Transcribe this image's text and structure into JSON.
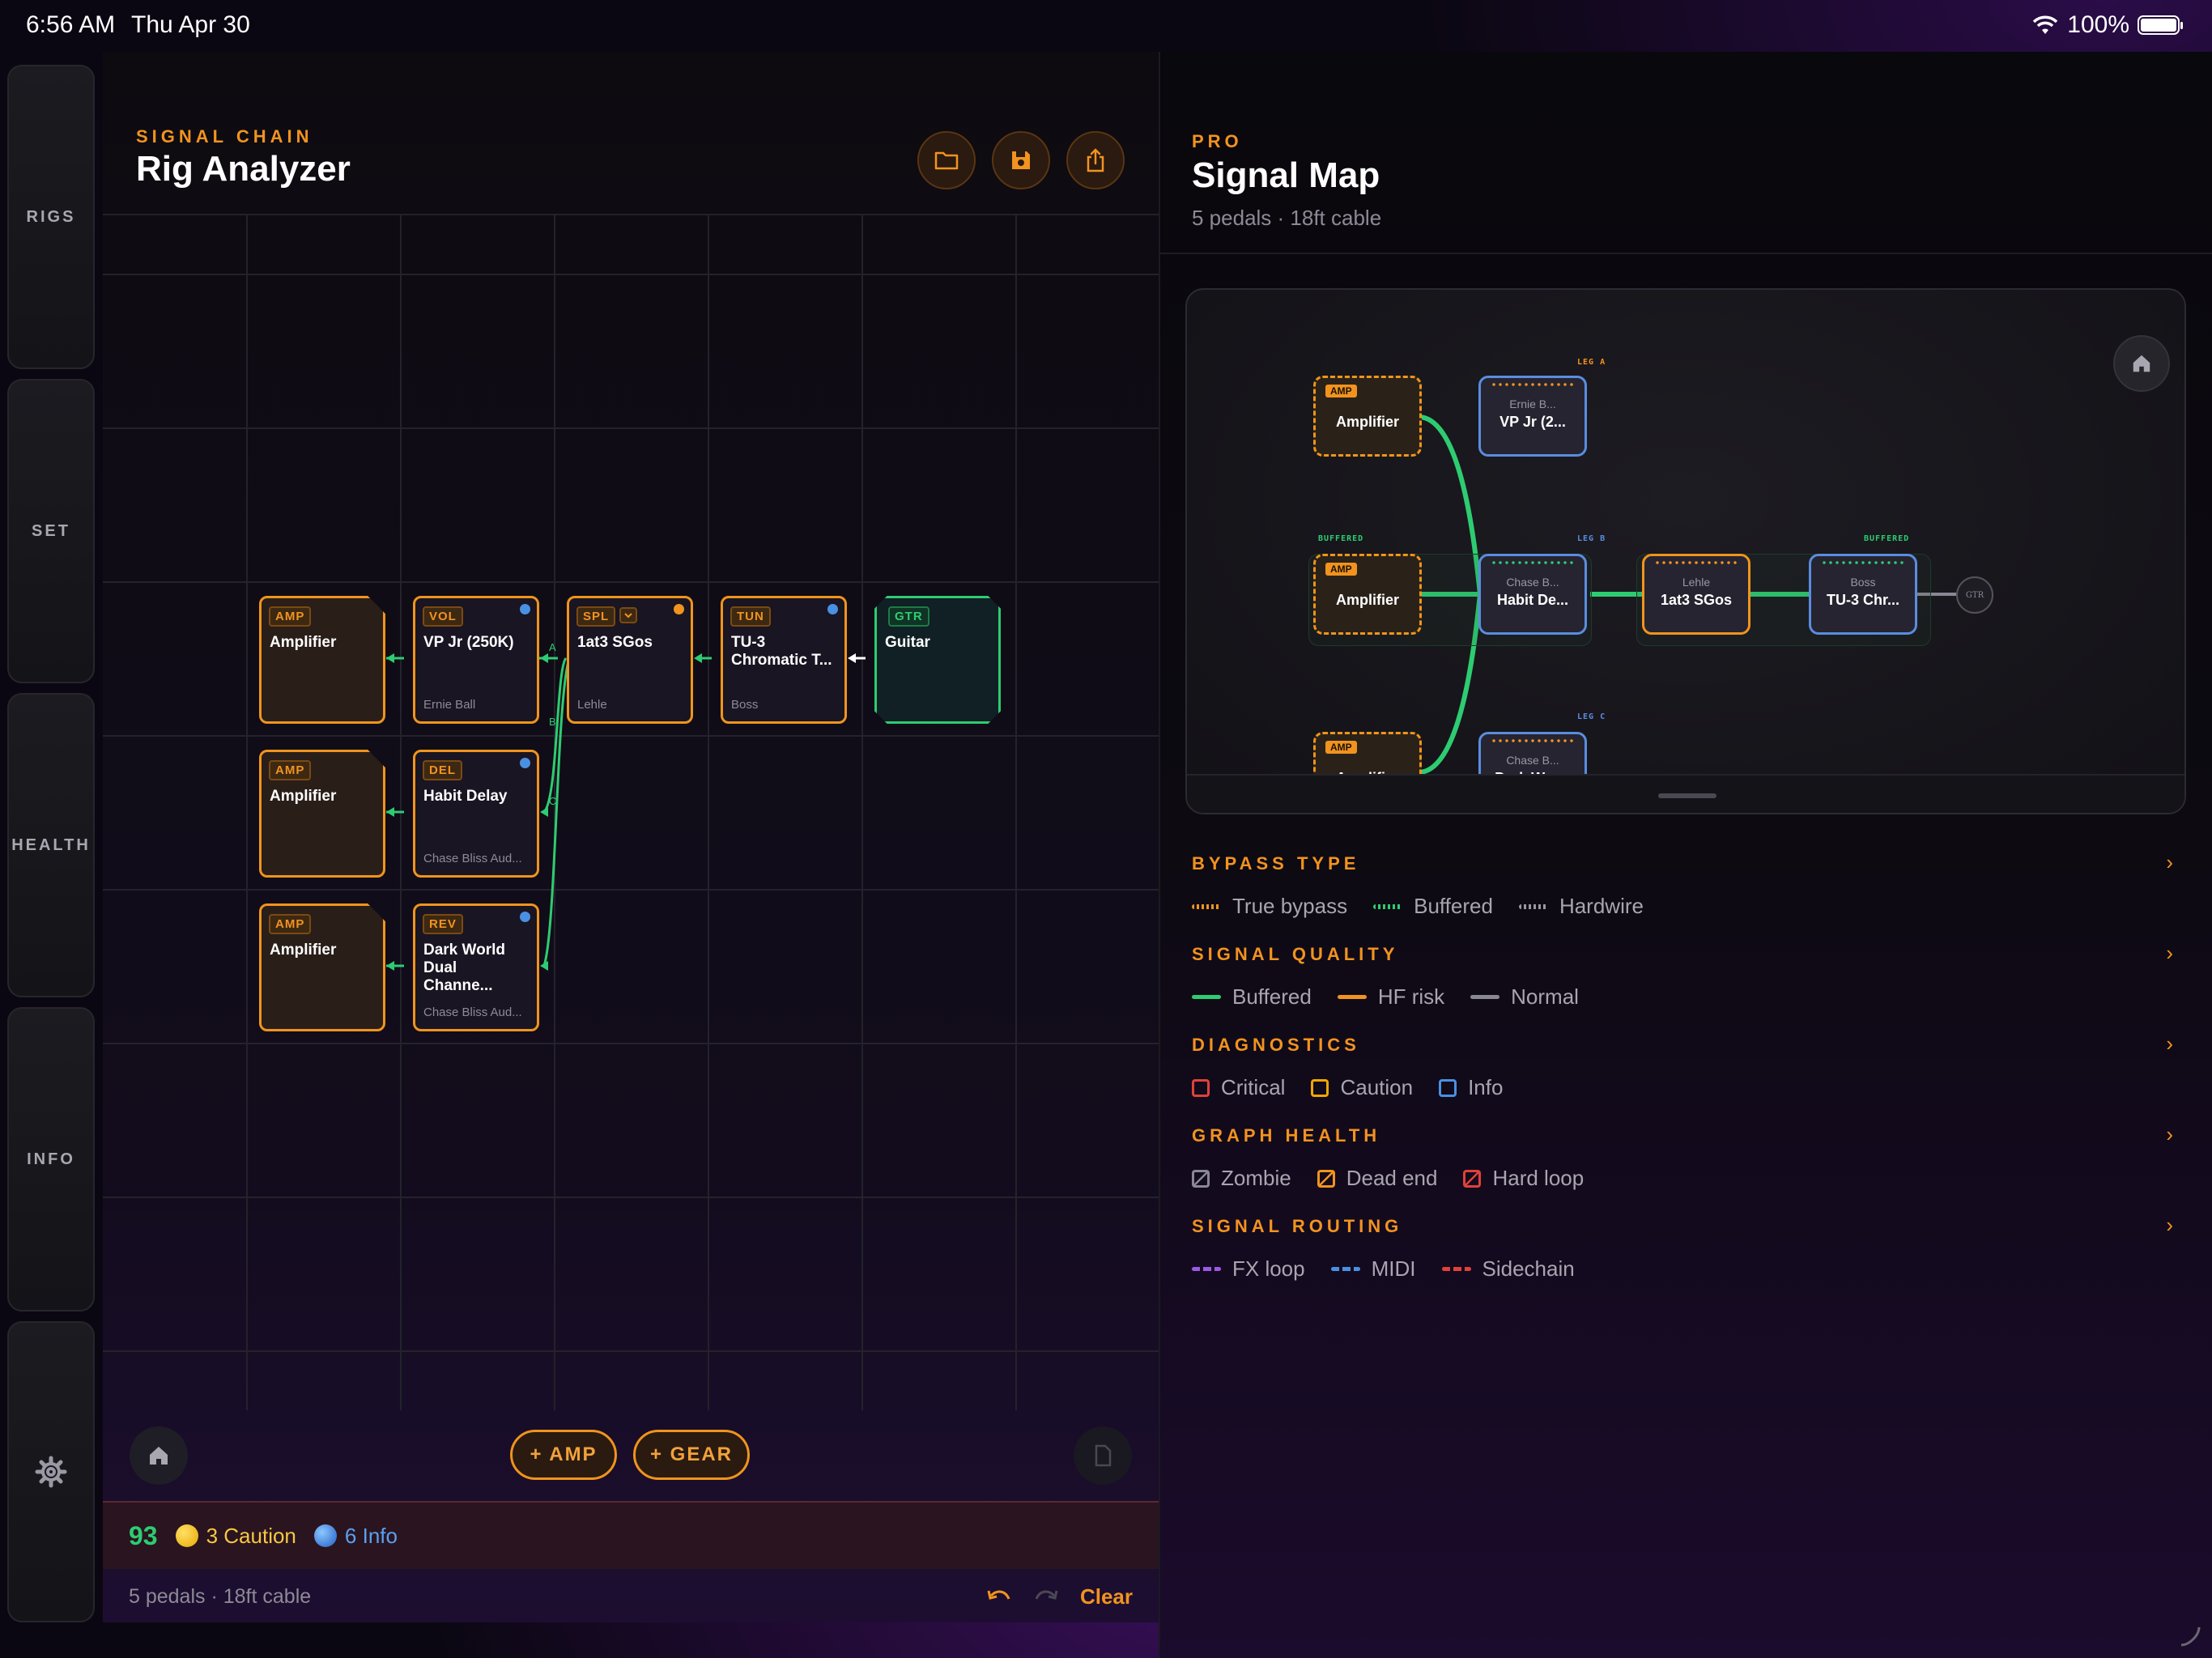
{
  "status_bar": {
    "time": "6:56 AM",
    "date": "Thu Apr 30",
    "battery": "100%"
  },
  "sidebar": {
    "tabs": [
      {
        "label": "RIGS"
      },
      {
        "label": "SET"
      },
      {
        "label": "HEALTH"
      },
      {
        "label": "INFO"
      }
    ]
  },
  "left": {
    "kicker": "SIGNAL CHAIN",
    "title": "Rig Analyzer",
    "nodes": [
      {
        "badge": "AMP",
        "name": "Amplifier",
        "brand": ""
      },
      {
        "badge": "VOL",
        "name": "VP Jr (250K)",
        "brand": "Ernie Ball"
      },
      {
        "badge": "SPL",
        "name": "1at3 SGos",
        "brand": "Lehle"
      },
      {
        "badge": "TUN",
        "name": "TU-3 Chromatic T...",
        "brand": "Boss"
      },
      {
        "badge": "GTR",
        "name": "Guitar",
        "brand": ""
      },
      {
        "badge": "AMP",
        "name": "Amplifier",
        "brand": ""
      },
      {
        "badge": "DEL",
        "name": "Habit Delay",
        "brand": "Chase Bliss Aud..."
      },
      {
        "badge": "AMP",
        "name": "Amplifier",
        "brand": ""
      },
      {
        "badge": "REV",
        "name": "Dark World Dual Channe...",
        "brand": "Chase Bliss Aud..."
      }
    ],
    "leg_labels": [
      "A",
      "B",
      "C"
    ],
    "add_amp": "+ AMP",
    "add_gear": "+ GEAR",
    "health": {
      "score": "93",
      "caution": "3 Caution",
      "info": "6 Info"
    },
    "footer": {
      "summary": "5 pedals · 18ft cable",
      "clear": "Clear"
    }
  },
  "right": {
    "kicker": "PRO",
    "title": "Signal Map",
    "subtitle": "5 pedals · 18ft cable",
    "map": {
      "leg_a": "LEG A",
      "leg_b": "LEG B",
      "leg_c": "LEG C",
      "buffered": "BUFFERED",
      "amp_badge": "AMP",
      "amp_name": "Amplifier",
      "vp_sub": "Ernie B...",
      "vp_name": "VP Jr (2...",
      "habit_sub": "Chase B...",
      "habit_name": "Habit De...",
      "lehle_sub": "Lehle",
      "lehle_name": "1at3 SGos",
      "boss_sub": "Boss",
      "boss_name": "TU-3 Chr...",
      "dark_sub": "Chase B...",
      "dark_name": "Dark Wor...",
      "gtr": "GTR",
      "amp_partial": "Amplifier"
    },
    "legend": [
      {
        "heading": "BYPASS TYPE",
        "items": [
          "True bypass",
          "Buffered",
          "Hardwire"
        ]
      },
      {
        "heading": "SIGNAL QUALITY",
        "items": [
          "Buffered",
          "HF risk",
          "Normal"
        ]
      },
      {
        "heading": "DIAGNOSTICS",
        "items": [
          "Critical",
          "Caution",
          "Info"
        ]
      },
      {
        "heading": "GRAPH HEALTH",
        "items": [
          "Zombie",
          "Dead end",
          "Hard loop"
        ]
      },
      {
        "heading": "SIGNAL ROUTING",
        "items": [
          "FX loop",
          "MIDI",
          "Sidechain"
        ]
      }
    ]
  },
  "colors": {
    "accent": "#f2931f",
    "buffered": "#2ecc71",
    "info": "#4a90e2",
    "critical": "#e0413b",
    "purple": "#9b59e6"
  }
}
